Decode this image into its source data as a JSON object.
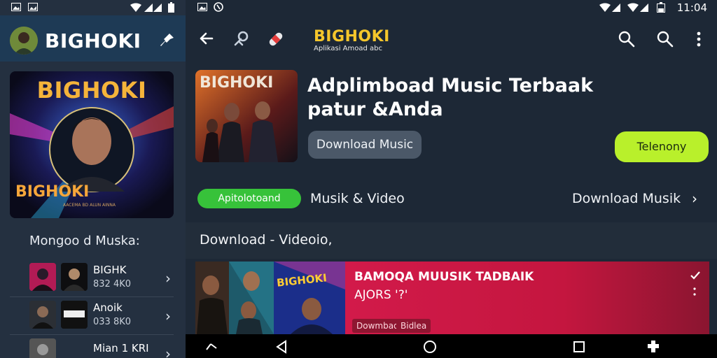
{
  "left_panel": {
    "title": "BIGHOKI",
    "cover": {
      "top_text": "BIGHOKI",
      "bottom_text": "BIGHOKI",
      "small_text": "AACEMA BD ALUN AINNA"
    },
    "section_title": "Mongoo d Muska:",
    "tracks": [
      {
        "title": "BIGHK",
        "subtitle": "832 4K0"
      },
      {
        "title": "Anoik",
        "subtitle": "033 8K0"
      },
      {
        "title": "Mian 1 KRI",
        "subtitle": ""
      }
    ]
  },
  "right_panel": {
    "time": "11:04",
    "brand": "BIGHOKI",
    "brand_sub": "Aplikasi Amoad abc",
    "hero": {
      "art_text": "BIGHOKI",
      "title": "Adplimboad Music Terbaak patur &Anda",
      "download_button": "Download Music",
      "lime_button": "Telenony"
    },
    "tabs": {
      "pill": "Apitolotoand",
      "musik_video": "Musik & Video",
      "download_musik": "Download Musik"
    },
    "section_title": "Download - Videoio,",
    "card": {
      "art_text": "BIGHOKI",
      "title": "BAMOQA MUUSIK TADBAIK",
      "subtitle": "AJORS '?'",
      "tags": [
        "Dowmbad",
        "Bidlea"
      ]
    }
  },
  "colors": {
    "accent_green": "#37c23a",
    "accent_lime": "#b9f02b",
    "brand": "#f5c62b",
    "card_red": "#d21a4a"
  },
  "icons": [
    "image-icon",
    "gallery-icon",
    "wifi-icon",
    "signal-icon",
    "battery-icon",
    "whatsapp-icon",
    "back-arrow-icon",
    "link-icon",
    "bandage-icon",
    "search-icon",
    "more-vert-icon",
    "pin-icon",
    "chevron-right-icon",
    "nav-back-icon",
    "nav-home-icon",
    "nav-recents-icon",
    "puzzle-icon"
  ]
}
